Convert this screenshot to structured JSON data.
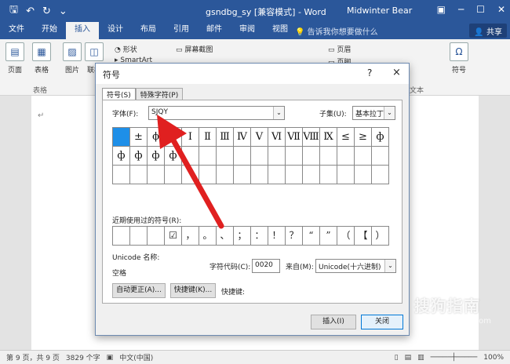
{
  "window": {
    "title": "gsndbg_sy [兼容模式] - Word",
    "user": "Midwinter Bear"
  },
  "tabs": [
    "文件",
    "开始",
    "插入",
    "设计",
    "布局",
    "引用",
    "邮件",
    "审阅",
    "视图"
  ],
  "tell_me": "告诉我你想要做什么",
  "share": "共享",
  "ribbon": {
    "page": "页面",
    "table": "表格",
    "picture": "图片",
    "online": "联机",
    "shapes": "形状",
    "screenshot": "屏幕截图",
    "smartart": "SmartArt",
    "header": "页眉",
    "footer": "页脚",
    "symbol": "符号",
    "table_group": "表格",
    "text_group": "文本"
  },
  "dialog": {
    "title": "符号",
    "help": "?",
    "close": "×",
    "tab_symbols": "符号(S)",
    "tab_special": "特殊字符(P)",
    "font_label": "字体(F):",
    "font_value": "SJQY",
    "subset_label": "子集(U):",
    "subset_value": "基本拉丁语",
    "symbols": [
      "",
      "±",
      "ϕ",
      "",
      "Ⅰ",
      "Ⅱ",
      "Ⅲ",
      "Ⅳ",
      "Ⅴ",
      "Ⅵ",
      "Ⅶ",
      "Ⅷ",
      "Ⅸ",
      "≤",
      "≥",
      "ф",
      "ф",
      "ф",
      "ф",
      "ф",
      "",
      "",
      "",
      "",
      "",
      "",
      "",
      "",
      "",
      "",
      "",
      ""
    ],
    "recent_label": "近期使用过的符号(R):",
    "recent": [
      "",
      "",
      "",
      "☑",
      "，",
      "。",
      "、",
      "；",
      "：",
      "！",
      "？",
      "“",
      "”",
      "（",
      "【",
      "）"
    ],
    "unicode_name_label": "Unicode 名称:",
    "unicode_name_value": "空格",
    "char_code_label": "字符代码(C):",
    "char_code_value": "0020",
    "from_label": "来自(M):",
    "from_value": "Unicode(十六进制)",
    "autocorrect": "自动更正(A)...",
    "shortcut_key_btn": "快捷键(K)...",
    "shortcut_label": "快捷键:",
    "insert": "插入(I)",
    "close_btn": "关闭"
  },
  "status": {
    "page": "第 9 页，共 9 页",
    "words": "3829 个字",
    "lang": "中文(中国)",
    "zoom": "100%"
  },
  "watermark": {
    "brand": "搜狗指南",
    "url": "zhinan.sogou.com"
  }
}
